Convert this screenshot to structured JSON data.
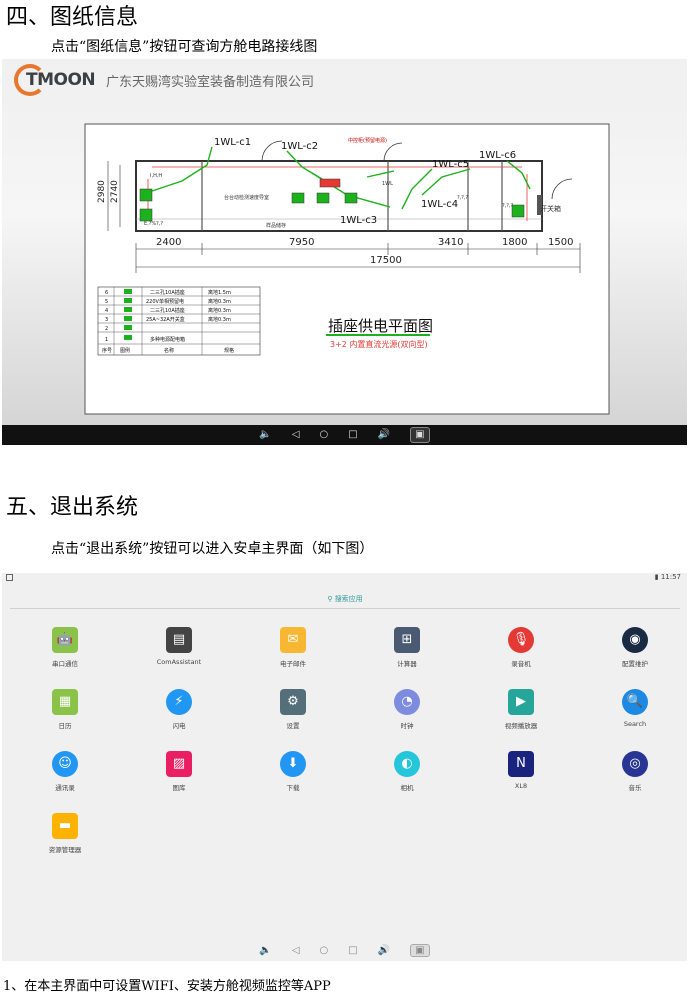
{
  "section4": {
    "heading": "四、图纸信息",
    "text": "点击“图纸信息”按钮可查询方舱电路接线图"
  },
  "viewer": {
    "logo": "TMOON",
    "company": "广东天赐湾实验室装备制造有限公司",
    "drawing": {
      "dims_left": [
        "2980",
        "2740"
      ],
      "dims_bottom": [
        "2400",
        "7950",
        "3410",
        "1800",
        "1500"
      ],
      "dim_total": "17500",
      "circuits": [
        "1WL-c1",
        "1WL-c2",
        "1WL-c3",
        "1WL-c4",
        "1WL-c5",
        "1WL-c6"
      ],
      "labels": {
        "middle_box": "中控柜(预留电源)",
        "switch_box": "开关箱",
        "sample_room": "样品储存",
        "workbench": "台台动检测速度导室",
        "small_1": "I,H,H",
        "small_2": "E,?%?,?",
        "small_3": "?,?,?",
        "small_4": "?,?,?",
        "small_5": "1WL"
      },
      "title": "插座供电平面图",
      "subtitle": "3+2 内置直流光源(双向型)",
      "legend_rows": [
        [
          "6",
          "二三孔10A插座",
          "离地1.5m"
        ],
        [
          "5",
          "220V单相预留电",
          "离地0.3m"
        ],
        [
          "4",
          "二三孔10A插座",
          "离地0.3m"
        ],
        [
          "3",
          "25A~32A开关盒",
          "离地0.3m"
        ],
        [
          "2",
          "",
          ""
        ],
        [
          "1",
          "多种电源配电箱",
          ""
        ]
      ],
      "legend_footer": [
        "序号",
        "图例",
        "名称",
        "规格"
      ]
    },
    "nav_icons": [
      "volume-down-icon",
      "back-icon",
      "home-icon",
      "recents-icon",
      "volume-up-icon",
      "screenshot-icon"
    ]
  },
  "section5": {
    "heading": "五、退出系统",
    "text": "点击“退出系统”按钮可以进入安卓主界面（如下图）"
  },
  "launcher": {
    "time": "11:57",
    "search": "搜索应用",
    "apps": [
      {
        "label": "串口通信",
        "icon": "android-icon",
        "color": "#8bc34a"
      },
      {
        "label": "ComAssistant",
        "icon": "chip-icon",
        "color": "#444444"
      },
      {
        "label": "电子邮件",
        "icon": "mail-icon",
        "color": "#f7b733"
      },
      {
        "label": "计算器",
        "icon": "calculator-icon",
        "color": "#4a5a73"
      },
      {
        "label": "录音机",
        "icon": "microphone-icon",
        "color": "#e53935"
      },
      {
        "label": "配置维护",
        "icon": "camera-lens-icon",
        "color": "#1a2a44"
      },
      {
        "label": "日历",
        "icon": "calendar-icon",
        "color": "#8bc34a"
      },
      {
        "label": "闪电",
        "icon": "cloud-bolt-icon",
        "color": "#2196f3"
      },
      {
        "label": "设置",
        "icon": "gear-icon",
        "color": "#546e7a"
      },
      {
        "label": "时钟",
        "icon": "clock-icon",
        "color": "#7e8ce0"
      },
      {
        "label": "视频播放器",
        "icon": "video-player-icon",
        "color": "#26a69a"
      },
      {
        "label": "Search",
        "icon": "magnifier-icon",
        "color": "#1e88e5"
      },
      {
        "label": "通讯录",
        "icon": "contacts-icon",
        "color": "#2196f3"
      },
      {
        "label": "图库",
        "icon": "gallery-icon",
        "color": "#e91e63"
      },
      {
        "label": "下载",
        "icon": "download-icon",
        "color": "#2196f3"
      },
      {
        "label": "相机",
        "icon": "aperture-icon",
        "color": "#26c6da"
      },
      {
        "label": "XL8",
        "icon": "nfc-icon",
        "color": "#1a237e"
      },
      {
        "label": "音乐",
        "icon": "speaker-icon",
        "color": "#283593"
      },
      {
        "label": "资源管理器",
        "icon": "folder-icon",
        "color": "#ffb300"
      }
    ],
    "nav_icons": [
      "volume-down-icon",
      "back-icon",
      "home-icon",
      "recents-icon",
      "volume-up-icon",
      "screenshot-icon"
    ]
  },
  "footer": "1、在本主界面中可设置WIFI、安装方舱视频监控等APP"
}
